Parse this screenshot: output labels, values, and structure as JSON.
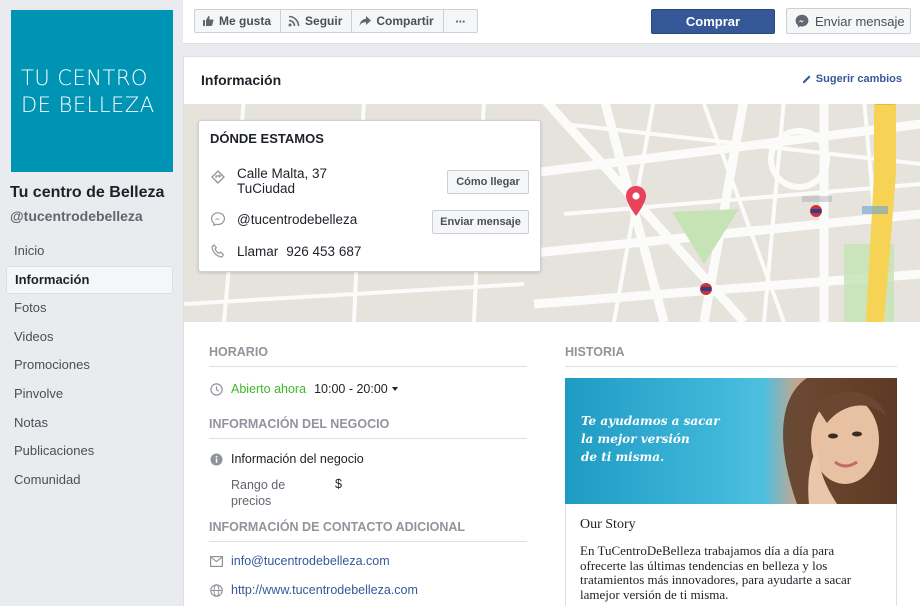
{
  "sidebar": {
    "cover_lines": [
      "TU CENTRO",
      "DE BELLEZA"
    ],
    "page_name": "Tu centro de Belleza",
    "page_handle": "@tucentrodebelleza",
    "items": [
      {
        "label": "Inicio"
      },
      {
        "label": "Información"
      },
      {
        "label": "Fotos"
      },
      {
        "label": "Videos"
      },
      {
        "label": "Promociones"
      },
      {
        "label": "Pinvolve"
      },
      {
        "label": "Notas"
      },
      {
        "label": "Publicaciones"
      },
      {
        "label": "Comunidad"
      }
    ]
  },
  "toolbar": {
    "like_label": "Me gusta",
    "follow_label": "Seguir",
    "share_label": "Compartir",
    "more_label": "···",
    "buy_label": "Comprar",
    "message_label": "Enviar mensaje"
  },
  "info": {
    "title": "Información",
    "suggest_label": "Sugerir cambios",
    "location": {
      "title": "DÓNDE ESTAMOS",
      "address_line1": "Calle Malta, 37",
      "address_line2": "TuCiudad",
      "directions_label": "Cómo llegar",
      "messenger": "@tucentrodebelleza",
      "message_label": "Enviar mensaje",
      "call_label": "Llamar",
      "phone": "926 453 687"
    },
    "hours": {
      "heading": "HORARIO",
      "status": "Abierto ahora",
      "range": "10:00 - 20:00"
    },
    "business": {
      "heading": "INFORMACIÓN DEL NEGOCIO",
      "label": "Información del negocio",
      "price_label_1": "Rango de",
      "price_label_2": "precios",
      "price_value": "$"
    },
    "contact": {
      "heading": "INFORMACIÓN DE CONTACTO ADICIONAL",
      "email": "info@tucentrodebelleza.com",
      "website": "http://www.tucentrodebelleza.com"
    },
    "history": {
      "heading": "HISTORIA",
      "image_text_1": "Te ayudamos a sacar",
      "image_text_2": "la mejor versión",
      "image_text_3": "de ti misma.",
      "story_title": "Our Story",
      "story_text": "En TuCentroDeBelleza trabajamos día  a día para ofrecerte las últimas tendencias en belleza y los tratamientos más innovadores, para ayudarte a sacar lamejor versión de ti misma."
    }
  },
  "colors": {
    "brand_cover": "#0094b4",
    "primary_button": "#365899",
    "open_status": "#42b72a",
    "map_pin": "#e8435a"
  }
}
